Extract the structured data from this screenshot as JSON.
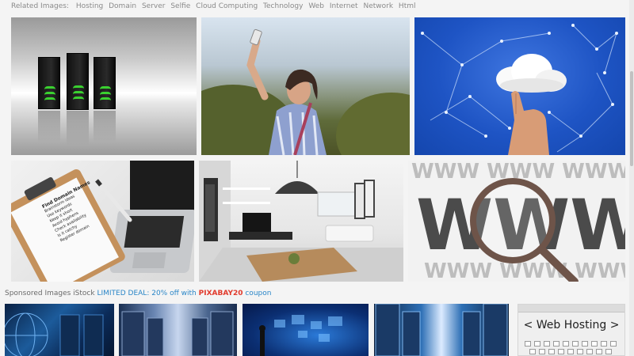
{
  "related": {
    "label": "Related Images:",
    "tags": [
      "Hosting",
      "Domain",
      "Server",
      "Selfie",
      "Cloud Computing",
      "Technology",
      "Web",
      "Internet",
      "Network",
      "Html"
    ]
  },
  "tiles": [
    {
      "subject": "server towers"
    },
    {
      "subject": "woman taking selfie"
    },
    {
      "subject": "hand touching cloud"
    },
    {
      "subject": "clipboard and laptop",
      "clipboard_heading": "Find Domain Names",
      "clipboard_lines": [
        "Brainstorm ideas",
        "Use keywords",
        "Keep it short",
        "Avoid hyphens",
        "Check availability",
        "Is it catchy",
        "Register domain"
      ]
    },
    {
      "subject": "modern living room"
    },
    {
      "subject": "www magnifier",
      "big_text": "WWW",
      "small_text": "WWW"
    }
  ],
  "sponsored": {
    "prefix": "Sponsored Images iStock",
    "deal": "LIMITED DEAL: 20% off with",
    "code": "PIXABAY20",
    "suffix": "coupon"
  },
  "stock": {
    "web_hosting_label": "< Web Hosting >"
  },
  "colors": {
    "deal": "#2a86c7",
    "code": "#e13a2c",
    "server_glow": "#3ad130"
  }
}
